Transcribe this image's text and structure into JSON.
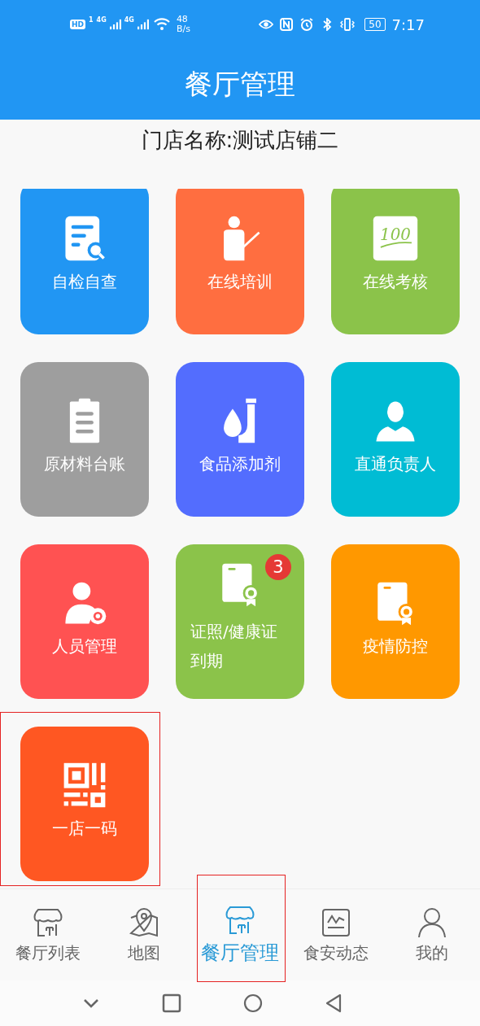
{
  "status_bar": {
    "hd": "HD",
    "sim": "1",
    "net1": "4G",
    "net2": "4G",
    "speed_value": "48",
    "speed_unit": "B/s",
    "battery": "50",
    "time": "7:17"
  },
  "title": "餐厅管理",
  "store_name": "门店名称:测试店铺二",
  "tiles": [
    {
      "label": "自检自查",
      "kind": "report",
      "color": "#2196f3",
      "highlighted": false
    },
    {
      "label": "在线培训",
      "kind": "trainer",
      "color": "#ff6e40",
      "highlighted": false
    },
    {
      "label": "在线考核",
      "kind": "score",
      "icon_text": "100",
      "color": "#8bc34a",
      "highlighted": false
    },
    {
      "label": "原材料台账",
      "kind": "clipboard",
      "color": "#9e9e9e",
      "highlighted": false
    },
    {
      "label": "食品添加剂",
      "kind": "additive",
      "color": "#536dfe",
      "highlighted": false
    },
    {
      "label": "直通负责人",
      "kind": "manager",
      "color": "#00bcd4",
      "highlighted": false
    },
    {
      "label": "人员管理",
      "kind": "staff",
      "color": "#ff5252",
      "highlighted": false
    },
    {
      "label": "证照/健康证到期",
      "kind": "certificate",
      "color": "#8bc34a",
      "badge": "3",
      "highlighted": false
    },
    {
      "label": "疫情防控",
      "kind": "certificate",
      "color": "#ff9800",
      "highlighted": false
    },
    {
      "label": "一店一码",
      "kind": "qr",
      "color": "#ff5722",
      "highlighted": true
    }
  ],
  "nav": [
    {
      "label": "餐厅列表",
      "kind": "shop",
      "selected": false,
      "highlighted": false
    },
    {
      "label": "地图",
      "kind": "map",
      "selected": false,
      "highlighted": false
    },
    {
      "label": "餐厅管理",
      "kind": "shop",
      "selected": true,
      "highlighted": true
    },
    {
      "label": "食安动态",
      "kind": "chart",
      "selected": false,
      "highlighted": false
    },
    {
      "label": "我的",
      "kind": "person",
      "selected": false,
      "highlighted": false
    }
  ]
}
